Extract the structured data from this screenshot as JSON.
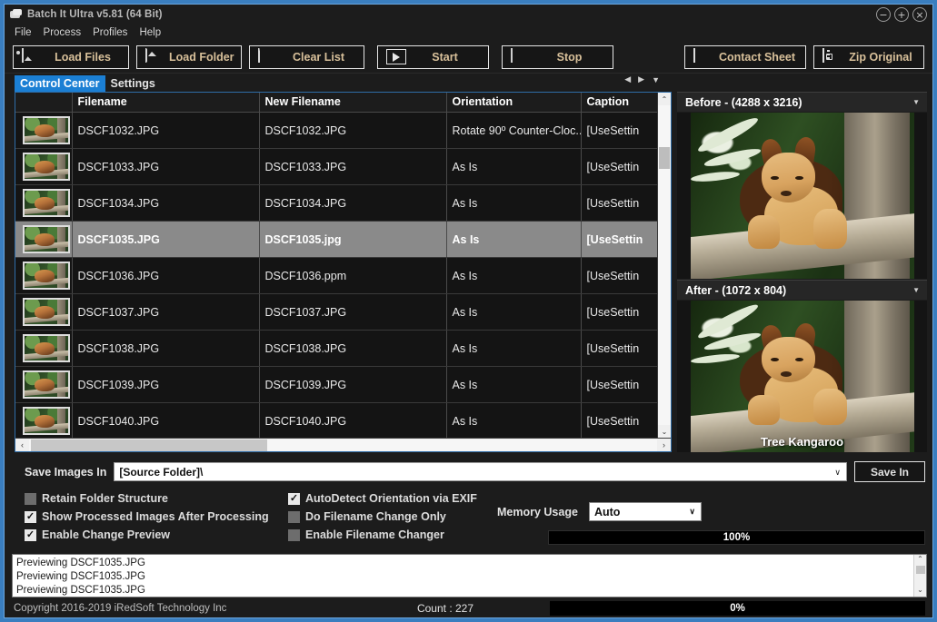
{
  "window": {
    "title": "Batch It Ultra v5.81 (64 Bit)",
    "minimize": "−",
    "maximize": "+",
    "close": "×"
  },
  "menu": [
    "File",
    "Process",
    "Profiles",
    "Help"
  ],
  "toolbar": [
    {
      "label": "Load Files",
      "icon": "images-icon"
    },
    {
      "label": "Load Folder",
      "icon": "folder-images-icon"
    },
    {
      "label": "Clear List",
      "icon": "document-icon"
    },
    {
      "label": "Start",
      "icon": "play-icon"
    },
    {
      "label": "Stop",
      "icon": "stop-icon"
    },
    {
      "label": "Contact Sheet",
      "icon": "grid-icon"
    },
    {
      "label": "Zip Original",
      "icon": "zip-icon"
    }
  ],
  "tabs": [
    {
      "label": "Control Center",
      "active": true
    },
    {
      "label": "Settings",
      "active": false
    }
  ],
  "tab_nav": {
    "prev": "◀",
    "next": "▶",
    "menu": "▼"
  },
  "grid": {
    "columns": [
      "",
      "Filename",
      "New Filename",
      "Orientation",
      "Caption"
    ],
    "rows": [
      {
        "filename": "DSCF1032.JPG",
        "new_filename": "DSCF1032.JPG",
        "orientation": "Rotate 90º Counter-Cloc...",
        "caption": "[UseSettin",
        "selected": false
      },
      {
        "filename": "DSCF1033.JPG",
        "new_filename": "DSCF1033.JPG",
        "orientation": "As Is",
        "caption": "[UseSettin",
        "selected": false
      },
      {
        "filename": "DSCF1034.JPG",
        "new_filename": "DSCF1034.JPG",
        "orientation": "As Is",
        "caption": "[UseSettin",
        "selected": false
      },
      {
        "filename": "DSCF1035.JPG",
        "new_filename": "DSCF1035.jpg",
        "orientation": "As Is",
        "caption": "[UseSettin",
        "selected": true
      },
      {
        "filename": "DSCF1036.JPG",
        "new_filename": "DSCF1036.ppm",
        "orientation": "As Is",
        "caption": "[UseSettin",
        "selected": false
      },
      {
        "filename": "DSCF1037.JPG",
        "new_filename": "DSCF1037.JPG",
        "orientation": "As Is",
        "caption": "[UseSettin",
        "selected": false
      },
      {
        "filename": "DSCF1038.JPG",
        "new_filename": "DSCF1038.JPG",
        "orientation": "As Is",
        "caption": "[UseSettin",
        "selected": false
      },
      {
        "filename": "DSCF1039.JPG",
        "new_filename": "DSCF1039.JPG",
        "orientation": "As Is",
        "caption": "[UseSettin",
        "selected": false
      },
      {
        "filename": "DSCF1040.JPG",
        "new_filename": "DSCF1040.JPG",
        "orientation": "As Is",
        "caption": "[UseSettin",
        "selected": false
      }
    ],
    "vscroll": {
      "up": "⌃",
      "down": "⌄"
    },
    "hscroll": {
      "left": "‹",
      "right": "›"
    }
  },
  "preview": {
    "before": {
      "title": "Before -  (4288 x 3216)",
      "caret": "▼"
    },
    "after": {
      "title": "After - (1072 x 804)",
      "caret": "▼",
      "overlay_caption": "Tree Kangaroo"
    }
  },
  "save": {
    "label": "Save Images In",
    "path_value": "[Source Folder]\\",
    "path_caret": "∨",
    "button": "Save In"
  },
  "options": {
    "left": [
      {
        "label": "Retain Folder Structure",
        "checked": false
      },
      {
        "label": "Show Processed Images After Processing",
        "checked": true
      },
      {
        "label": "Enable Change Preview",
        "checked": true
      }
    ],
    "right": [
      {
        "label": "AutoDetect Orientation via EXIF",
        "checked": true
      },
      {
        "label": "Do Filename Change Only",
        "checked": false
      },
      {
        "label": "Enable Filename Changer",
        "checked": false
      }
    ],
    "check_glyph": "✓"
  },
  "memory": {
    "label": "Memory Usage",
    "value": "Auto",
    "caret": "∨",
    "progress_label": "100%"
  },
  "log": {
    "lines": [
      "Previewing DSCF1035.JPG",
      "Previewing DSCF1035.JPG",
      "Previewing DSCF1035.JPG"
    ],
    "scroll_up": "⌃",
    "scroll_down": "⌄"
  },
  "statusbar": {
    "copyright": "Copyright 2016-2019 iRedSoft Technology Inc",
    "count": "Count : 227",
    "progress_label": "0%"
  },
  "colors": {
    "accent": "#1b7fd4",
    "button_text": "#d8c09a",
    "selected_row": "#8a8a8a",
    "window_border": "#6ba6dd"
  }
}
